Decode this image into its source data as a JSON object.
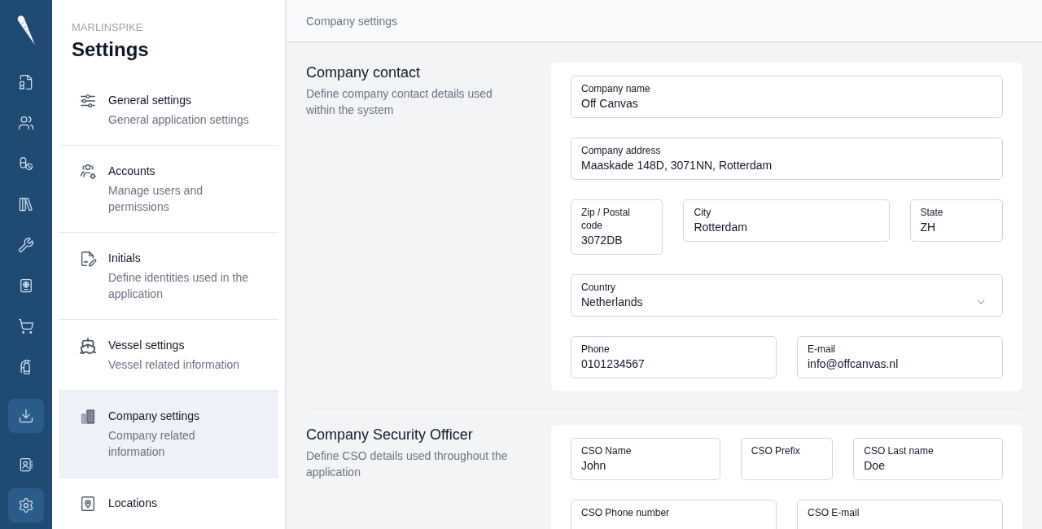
{
  "rail": {
    "groups": [
      {
        "items": [
          {
            "selected": false
          },
          {
            "selected": false
          },
          {
            "selected": false
          },
          {
            "selected": false
          },
          {
            "selected": false
          },
          {
            "selected": false
          },
          {
            "selected": false
          },
          {
            "selected": false
          }
        ]
      },
      {
        "items": [
          {
            "selected": true
          }
        ]
      },
      {
        "items": [
          {
            "selected": false
          },
          {
            "selected": true
          }
        ]
      }
    ]
  },
  "sidebar": {
    "brand": "MARLINSPIKE",
    "title": "Settings",
    "items": [
      {
        "title": "General settings",
        "description": "General application settings",
        "selected": false
      },
      {
        "title": "Accounts",
        "description": "Manage users and permissions",
        "selected": false
      },
      {
        "title": "Initials",
        "description": "Define identities used in the application",
        "selected": false
      },
      {
        "title": "Vessel settings",
        "description": "Vessel related information",
        "selected": false
      },
      {
        "title": "Company settings",
        "description": "Company related information",
        "selected": true
      },
      {
        "title": "Locations",
        "selected": false
      }
    ]
  },
  "header": {
    "title": "Company settings"
  },
  "sections": [
    {
      "title": "Company contact",
      "description": "Define company contact details used within the system",
      "rows": [
        {
          "fields": [
            {
              "kind": "text",
              "label": "Company name",
              "value": "Off Canvas"
            }
          ]
        },
        {
          "fields": [
            {
              "kind": "text",
              "label": "Company address",
              "value": "Maaskade 148D, 3071NN, Rotterdam"
            }
          ]
        },
        {
          "fields": [
            {
              "kind": "text",
              "label": "Zip / Postal code",
              "value": "3072DB"
            },
            {
              "kind": "text",
              "label": "City",
              "value": "Rotterdam"
            },
            {
              "kind": "text",
              "label": "State",
              "value": "ZH"
            }
          ]
        },
        {
          "fields": [
            {
              "kind": "select",
              "label": "Country",
              "value": "Netherlands"
            }
          ]
        },
        {
          "fields": [
            {
              "kind": "text",
              "label": "Phone",
              "value": "0101234567"
            },
            {
              "kind": "text",
              "label": "E-mail",
              "value": "info@offcanvas.nl"
            }
          ]
        }
      ]
    },
    {
      "title": "Company Security Officer",
      "description": "Define CSO details used throughout the application",
      "rows": [
        {
          "fields": [
            {
              "kind": "text",
              "label": "CSO Name",
              "value": "John"
            },
            {
              "kind": "text",
              "label": "CSO Prefix"
            },
            {
              "kind": "text",
              "label": "CSO Last name",
              "value": "Doe"
            }
          ]
        },
        {
          "fields": [
            {
              "kind": "text",
              "label": "CSO Phone number"
            },
            {
              "kind": "text",
              "label": "CSO E-mail"
            }
          ]
        }
      ]
    }
  ]
}
